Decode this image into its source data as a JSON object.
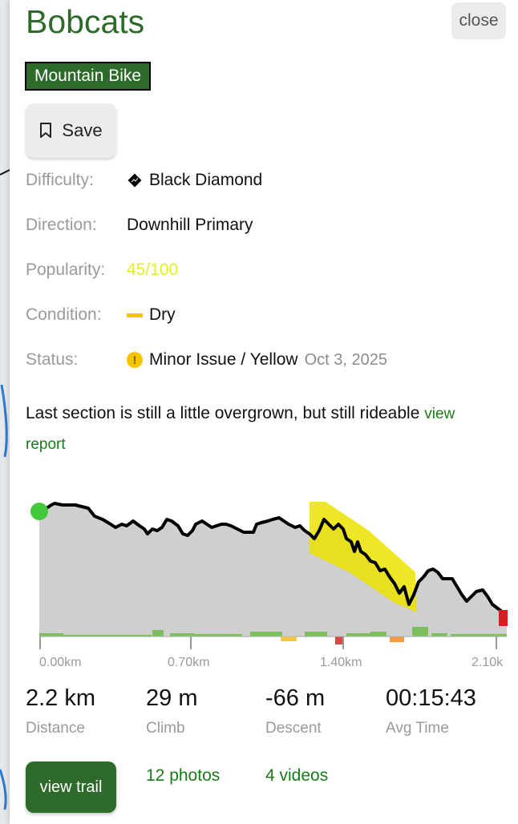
{
  "trail": {
    "name": "Bobcats",
    "type_badge": "Mountain Bike"
  },
  "actions": {
    "close_label": "close",
    "save_label": "Save"
  },
  "details": {
    "difficulty_label": "Difficulty:",
    "difficulty_value": "Black Diamond",
    "direction_label": "Direction:",
    "direction_value": "Downhill Primary",
    "popularity_label": "Popularity:",
    "popularity_value": "45/100",
    "condition_label": "Condition:",
    "condition_value": "Dry",
    "status_label": "Status:",
    "status_value": "Minor Issue / Yellow",
    "status_date": "Oct 3, 2025"
  },
  "report": {
    "text": "Last section is still a little overgrown, but still rideable",
    "link_label": "view report"
  },
  "profile": {
    "x_ticks": [
      "0.00km",
      "0.70km",
      "1.40km",
      "2.10k"
    ]
  },
  "stats": [
    {
      "value": "2.2 km",
      "label": "Distance"
    },
    {
      "value": "29 m",
      "label": "Climb"
    },
    {
      "value": "-66 m",
      "label": "Descent"
    },
    {
      "value": "00:15:43",
      "label": "Avg Time"
    }
  ],
  "footer": {
    "view_trail_label": "view trail",
    "photos_label": "12 photos",
    "videos_label": "4 videos"
  },
  "colors": {
    "brand_green": "#2e6b2a",
    "link_green": "#1a7a1a",
    "warning_yellow": "#f5c400",
    "popularity": "#e2ee2a"
  },
  "icons": {
    "difficulty": "black-diamond-icon",
    "save": "bookmark-icon",
    "status": "exclamation-circle-icon"
  }
}
